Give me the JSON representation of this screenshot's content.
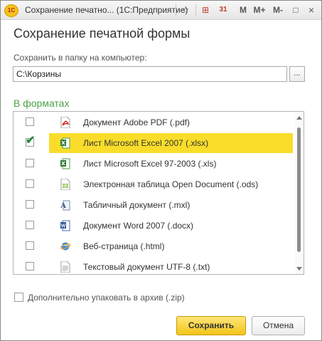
{
  "window": {
    "title": "Сохранение печатно...  (1С:Предприятие)",
    "logo_text": "1С",
    "toolbar": [
      "☆",
      "⊞",
      "31",
      "M",
      "M+",
      "M-",
      "□",
      "×"
    ]
  },
  "dialog": {
    "title": "Сохранение печатной формы",
    "folder_label": "Сохранить в папку на компьютер:",
    "folder_value": "C:\\Корзины",
    "browse_label": "...",
    "formats_heading": "В форматах",
    "formats": [
      {
        "label": "Документ Adobe PDF (.pdf)",
        "checked": false,
        "icon": "pdf-icon"
      },
      {
        "label": "Лист Microsoft Excel 2007 (.xlsx)",
        "checked": true,
        "icon": "excel-icon"
      },
      {
        "label": "Лист Microsoft Excel 97-2003 (.xls)",
        "checked": false,
        "icon": "excel-icon"
      },
      {
        "label": "Электронная таблица Open Document (.ods)",
        "checked": false,
        "icon": "ods-icon"
      },
      {
        "label": "Табличный документ (.mxl)",
        "checked": false,
        "icon": "mxl-icon"
      },
      {
        "label": "Документ Word 2007 (.docx)",
        "checked": false,
        "icon": "word-icon"
      },
      {
        "label": "Веб-страница (.html)",
        "checked": false,
        "icon": "html-icon"
      },
      {
        "label": "Текстовый документ UTF-8 (.txt)",
        "checked": false,
        "icon": "txt-icon"
      }
    ],
    "zip_label": "Дополнительно упаковать в архив (.zip)",
    "save_label": "Сохранить",
    "cancel_label": "Отмена",
    "check_mark": "✔"
  }
}
